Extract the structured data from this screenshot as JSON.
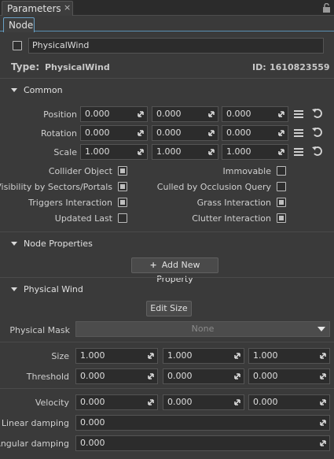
{
  "tabs": {
    "parameters": "Parameters",
    "close": "×",
    "node": "Node"
  },
  "node": {
    "name": "PhysicalWind",
    "type_label": "Type:",
    "type_value": "PhysicalWind",
    "id_label": "ID:",
    "id_value": "1610823559",
    "enabled": false
  },
  "common": {
    "title": "Common",
    "position": {
      "label": "Position",
      "values": [
        "0.000",
        "0.000",
        "0.000"
      ]
    },
    "rotation": {
      "label": "Rotation",
      "values": [
        "0.000",
        "0.000",
        "0.000"
      ]
    },
    "scale": {
      "label": "Scale",
      "values": [
        "1.000",
        "1.000",
        "1.000"
      ]
    },
    "flags": [
      {
        "label": "Collider Object",
        "checked": true
      },
      {
        "label": "Immovable",
        "checked": false
      },
      {
        "label": "Visibility by Sectors/Portals",
        "checked": true
      },
      {
        "label": "Culled by Occlusion Query",
        "checked": false
      },
      {
        "label": "Triggers Interaction",
        "checked": true
      },
      {
        "label": "Grass Interaction",
        "checked": true
      },
      {
        "label": "Updated Last",
        "checked": false
      },
      {
        "label": "Clutter Interaction",
        "checked": true
      }
    ]
  },
  "node_properties": {
    "title": "Node Properties",
    "add_button": "Add New Property"
  },
  "physical_wind": {
    "title": "Physical Wind",
    "edit_size_button": "Edit Size",
    "mask_label": "Physical Mask",
    "mask_value": "None",
    "size": {
      "label": "Size",
      "values": [
        "1.000",
        "1.000",
        "1.000"
      ]
    },
    "threshold": {
      "label": "Threshold",
      "values": [
        "0.000",
        "0.000",
        "0.000"
      ]
    },
    "velocity": {
      "label": "Velocity",
      "values": [
        "0.000",
        "0.000",
        "0.000"
      ]
    },
    "linear_damping": {
      "label": "Linear damping",
      "value": "0.000"
    },
    "angular_damping": {
      "label": "Angular damping",
      "value": "0.000"
    }
  },
  "colors": {
    "panel_bg": "#3a3a3a",
    "field_bg": "#2c2c2c",
    "accent_tab": "#6aa0c5"
  }
}
